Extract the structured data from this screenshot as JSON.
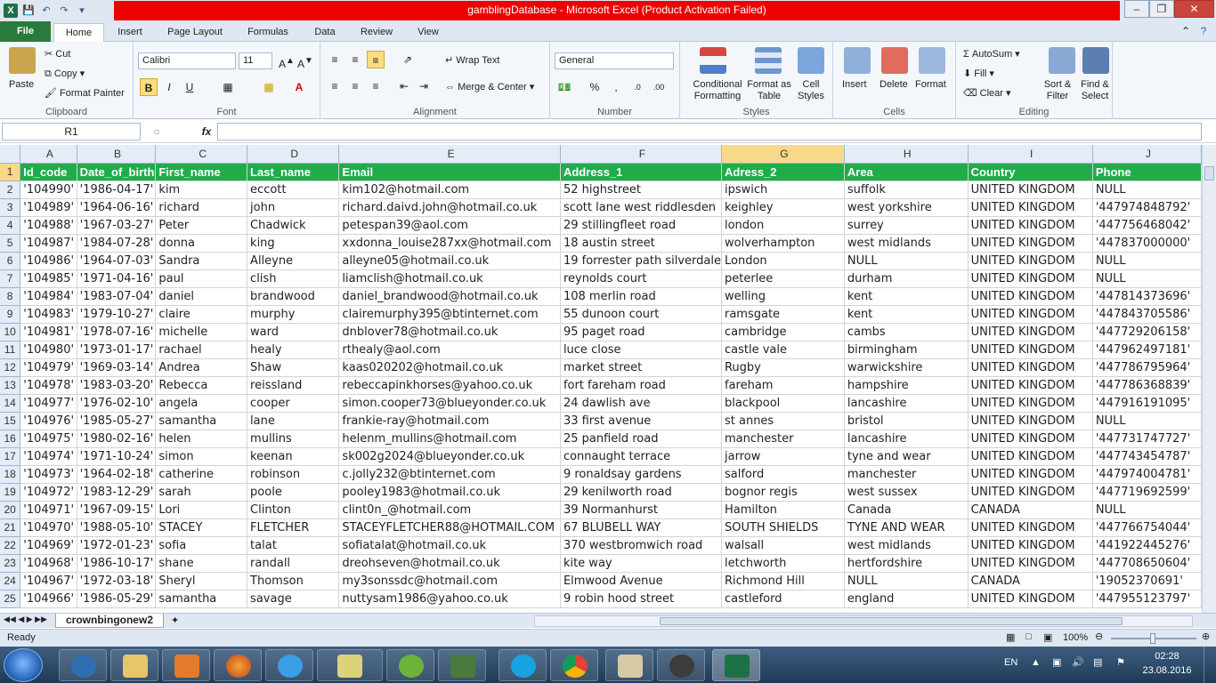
{
  "window": {
    "title": "gamblingDatabase - Microsoft Excel (Product Activation Failed)",
    "qat_icons": [
      "excel-icon",
      "save-icon",
      "undo-icon",
      "redo-icon",
      "customize-icon"
    ]
  },
  "ribbon_tabs": [
    "File",
    "Home",
    "Insert",
    "Page Layout",
    "Formulas",
    "Data",
    "Review",
    "View"
  ],
  "active_tab": "Home",
  "ribbon": {
    "clipboard": {
      "label": "Clipboard",
      "paste": "Paste",
      "cut": "Cut",
      "copy": "Copy",
      "format_painter": "Format Painter"
    },
    "font": {
      "label": "Font",
      "font_name": "Calibri",
      "font_size": "11",
      "bold": "B",
      "italic": "I",
      "underline": "U"
    },
    "alignment": {
      "label": "Alignment",
      "wrap_text": "Wrap Text",
      "merge_center": "Merge & Center"
    },
    "number": {
      "label": "Number",
      "format": "General",
      "percent": "%",
      "comma": ","
    },
    "styles": {
      "label": "Styles",
      "conditional": "Conditional Formatting",
      "format_table": "Format as Table",
      "cell_styles": "Cell Styles"
    },
    "cells": {
      "label": "Cells",
      "insert": "Insert",
      "delete": "Delete",
      "format": "Format"
    },
    "editing": {
      "label": "Editing",
      "autosum": "AutoSum",
      "fill": "Fill",
      "clear": "Clear",
      "sort_filter": "Sort & Filter",
      "find_select": "Find & Select"
    }
  },
  "formula_bar": {
    "name_box": "R1",
    "fx": "fx",
    "value": ""
  },
  "columns": [
    {
      "letter": "A"
    },
    {
      "letter": "B"
    },
    {
      "letter": "C"
    },
    {
      "letter": "D"
    },
    {
      "letter": "E"
    },
    {
      "letter": "F"
    },
    {
      "letter": "G"
    },
    {
      "letter": "H"
    },
    {
      "letter": "I"
    },
    {
      "letter": "J"
    }
  ],
  "header_row": [
    "Id_code",
    "Date_of_birth",
    "First_name",
    "Last_name",
    "Email",
    "Address_1",
    "Adress_2",
    "Area",
    "Country",
    "Phone"
  ],
  "rows": [
    [
      "'104990'",
      "'1986-04-17'",
      "kim",
      "eccott",
      "kim102@hotmail.com",
      "52 highstreet",
      "ipswich",
      "suffolk",
      "UNITED KINGDOM",
      "NULL"
    ],
    [
      "'104989'",
      "'1964-06-16'",
      "richard",
      "john",
      "richard.daivd.john@hotmail.co.uk",
      "scott lane west riddlesden",
      "keighley",
      "west yorkshire",
      "UNITED KINGDOM",
      "'447974848792'"
    ],
    [
      "'104988'",
      "'1967-03-27'",
      "Peter",
      "Chadwick",
      "petespan39@aol.com",
      "29 stillingfleet road",
      "london",
      "surrey",
      "UNITED KINGDOM",
      "'447756468042'"
    ],
    [
      "'104987'",
      "'1984-07-28'",
      "donna",
      "king",
      "xxdonna_louise287xx@hotmail.com",
      "18 austin street",
      "wolverhampton",
      "west midlands",
      "UNITED KINGDOM",
      "'447837000000'"
    ],
    [
      "'104986'",
      "'1964-07-03'",
      "Sandra",
      "Alleyne",
      "alleyne05@hotmail.co.uk",
      "19 forrester path silverdale",
      "London",
      "NULL",
      "UNITED KINGDOM",
      "NULL"
    ],
    [
      "'104985'",
      "'1971-04-16'",
      "paul",
      "clish",
      "liamclish@hotmail.co.uk",
      "reynolds court",
      "peterlee",
      "durham",
      "UNITED KINGDOM",
      "NULL"
    ],
    [
      "'104984'",
      "'1983-07-04'",
      "daniel",
      "brandwood",
      "daniel_brandwood@hotmail.co.uk",
      "108 merlin road",
      "welling",
      "kent",
      "UNITED KINGDOM",
      "'447814373696'"
    ],
    [
      "'104983'",
      "'1979-10-27'",
      "claire",
      "murphy",
      "clairemurphy395@btinternet.com",
      "55 dunoon court",
      "ramsgate",
      "kent",
      "UNITED KINGDOM",
      "'447843705586'"
    ],
    [
      "'104981'",
      "'1978-07-16'",
      "michelle",
      "ward",
      "dnblover78@hotmail.co.uk",
      "95 paget road",
      "cambridge",
      "cambs",
      "UNITED KINGDOM",
      "'447729206158'"
    ],
    [
      "'104980'",
      "'1973-01-17'",
      "rachael",
      "healy",
      "rthealy@aol.com",
      "luce close",
      "castle vale",
      "birmingham",
      "UNITED KINGDOM",
      "'447962497181'"
    ],
    [
      "'104979'",
      "'1969-03-14'",
      "Andrea",
      "Shaw",
      "kaas020202@hotmail.co.uk",
      "market street",
      "Rugby",
      "warwickshire",
      "UNITED KINGDOM",
      "'447786795964'"
    ],
    [
      "'104978'",
      "'1983-03-20'",
      "Rebecca",
      "reissland",
      "rebeccapinkhorses@yahoo.co.uk",
      "fort fareham road",
      "fareham",
      "hampshire",
      "UNITED KINGDOM",
      "'447786368839'"
    ],
    [
      "'104977'",
      "'1976-02-10'",
      "angela",
      "cooper",
      "simon.cooper73@blueyonder.co.uk",
      "24 dawlish ave",
      "blackpool",
      "lancashire",
      "UNITED KINGDOM",
      "'447916191095'"
    ],
    [
      "'104976'",
      "'1985-05-27'",
      "samantha",
      "lane",
      "frankie-ray@hotmail.com",
      "33 first avenue",
      "st annes",
      "bristol",
      "UNITED KINGDOM",
      "NULL"
    ],
    [
      "'104975'",
      "'1980-02-16'",
      "helen",
      "mullins",
      "helenm_mullins@hotmail.com",
      "25 panfield road",
      "manchester",
      "lancashire",
      "UNITED KINGDOM",
      "'447731747727'"
    ],
    [
      "'104974'",
      "'1971-10-24'",
      "simon",
      "keenan",
      "sk002g2024@blueyonder.co.uk",
      "connaught terrace",
      "jarrow",
      "tyne and wear",
      "UNITED KINGDOM",
      "'447743454787'"
    ],
    [
      "'104973'",
      "'1964-02-18'",
      "catherine",
      "robinson",
      "c.jolly232@btinternet.com",
      "9 ronaldsay gardens",
      "salford",
      "manchester",
      "UNITED KINGDOM",
      "'447974004781'"
    ],
    [
      "'104972'",
      "'1983-12-29'",
      "sarah",
      "poole",
      "pooley1983@hotmail.co.uk",
      "29 kenilworth road",
      "bognor regis",
      "west sussex",
      "UNITED KINGDOM",
      "'447719692599'"
    ],
    [
      "'104971'",
      "'1967-09-15'",
      "Lori",
      "Clinton",
      "clint0n_@hotmail.com",
      "39 Normanhurst",
      "Hamilton",
      "Canada",
      "CANADA",
      "NULL"
    ],
    [
      "'104970'",
      "'1988-05-10'",
      "STACEY",
      "FLETCHER",
      "STACEYFLETCHER88@HOTMAIL.COM",
      "67 BLUBELL WAY",
      "SOUTH SHIELDS",
      "TYNE AND WEAR",
      "UNITED KINGDOM",
      "'447766754044'"
    ],
    [
      "'104969'",
      "'1972-01-23'",
      "sofia",
      "talat",
      "sofiatalat@hotmail.co.uk",
      "370 westbromwich road",
      "walsall",
      "west midlands",
      "UNITED KINGDOM",
      "'441922445276'"
    ],
    [
      "'104968'",
      "'1986-10-17'",
      "shane",
      "randall",
      "dreohseven@hotmail.co.uk",
      "kite way",
      "letchworth",
      "hertfordshire",
      "UNITED KINGDOM",
      "'447708650604'"
    ],
    [
      "'104967'",
      "'1972-03-18'",
      "Sheryl",
      "Thomson",
      "my3sonssdc@hotmail.com",
      "Elmwood Avenue",
      "Richmond Hill",
      "NULL",
      "CANADA",
      "'19052370691'"
    ],
    [
      "'104966'",
      "'1986-05-29'",
      "samantha",
      "savage",
      "nuttysam1986@yahoo.co.uk",
      "9 robin hood street",
      "castleford",
      "england",
      "UNITED KINGDOM",
      "'447955123797'"
    ]
  ],
  "sheet_tab": "crownbingonew2",
  "status": {
    "ready": "Ready",
    "zoom": "100%"
  },
  "taskbar": {
    "lang": "EN",
    "time": "02:28",
    "date": "23.08.2016"
  },
  "colors": {
    "header_green": "#1fad4a",
    "file_tab": "#2a7a3b",
    "title_red": "#ee0000"
  }
}
